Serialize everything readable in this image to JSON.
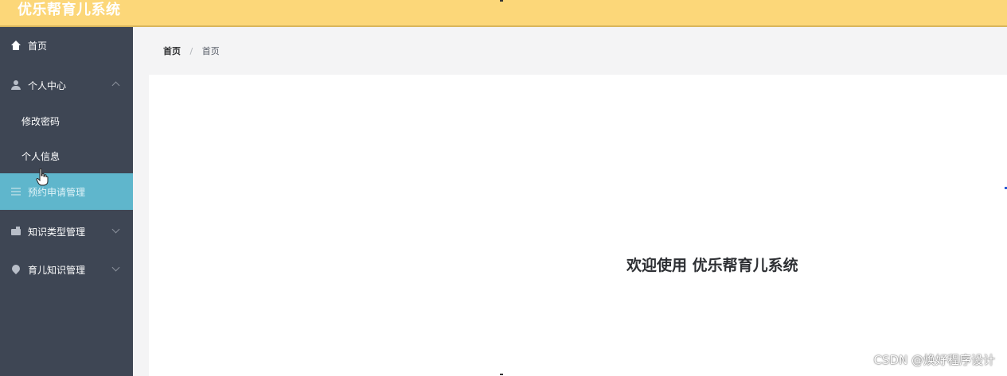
{
  "app": {
    "title": "优乐帮育儿系统"
  },
  "sidebar": {
    "items": [
      {
        "label": "首页",
        "icon": "home-icon"
      },
      {
        "label": "个人中心",
        "icon": "user-icon",
        "expanded": true,
        "children": [
          {
            "label": "修改密码"
          },
          {
            "label": "个人信息"
          }
        ]
      },
      {
        "label": "预约申请管理",
        "icon": "menu-icon",
        "active": true
      },
      {
        "label": "知识类型管理",
        "icon": "folder-icon"
      },
      {
        "label": "育儿知识管理",
        "icon": "pin-icon"
      }
    ]
  },
  "breadcrumb": {
    "home": "首页",
    "current": "首页"
  },
  "main": {
    "welcome": "欢迎使用 优乐帮育儿系统"
  },
  "watermark": "CSDN @焕好程序设计",
  "colors": {
    "topbar": "#fcd779",
    "sidebar": "#3e4654",
    "active_item": "#5fb6cc",
    "content_bg": "#ffffff"
  }
}
